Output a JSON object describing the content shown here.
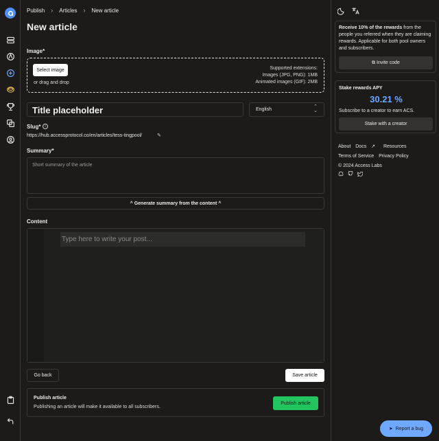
{
  "breadcrumb": [
    "Publish",
    "Articles",
    "New article"
  ],
  "page_title": "New article",
  "image": {
    "label": "Image*",
    "select_button": "Select image",
    "drag_text": "or drag and drop",
    "extensions": [
      "Supported extensions:",
      "Images (JPG, PNG): 1MB",
      "Animated images (GIF): 2MB"
    ]
  },
  "title_input": {
    "value": "Title placeholder"
  },
  "language_select": {
    "value": "English"
  },
  "slug": {
    "label": "Slug*",
    "url": "https://hub.accessprotocol.co/en/articles/tess-tingpool/"
  },
  "summary": {
    "label": "Summary*",
    "placeholder": "Short summary of the article"
  },
  "generate_button": "^ Generate summary from the content ^",
  "content": {
    "label": "Content",
    "placeholder": "Type here to write your post..."
  },
  "go_back": "Go back",
  "save_article": "Save article",
  "publish": {
    "heading": "Publish article",
    "description": "Publishing an article will make it available to all subscribers.",
    "button": "Publish article"
  },
  "rewards_card": {
    "bold": "Receive 10% of the rewards",
    "text": " from the people you referred when they are claiming rewards. Applicable for both pool owners and subscribers.",
    "button": "Invite code"
  },
  "stake_card": {
    "heading": "Stake rewards APY",
    "apy": "30.21 %",
    "subtitle": "Subscribe to a creator to earn ACS.",
    "button": "Stake with a creator"
  },
  "footer_links": [
    "About",
    "Docs",
    "Resources",
    "Terms of Service",
    "Privacy Policy",
    "© 2024 Access Labs"
  ],
  "report_bug": "Report a bug",
  "colors": {
    "accent": "#6ea8ff",
    "publish_green": "#22c55e",
    "background": "#1c1b1a"
  }
}
